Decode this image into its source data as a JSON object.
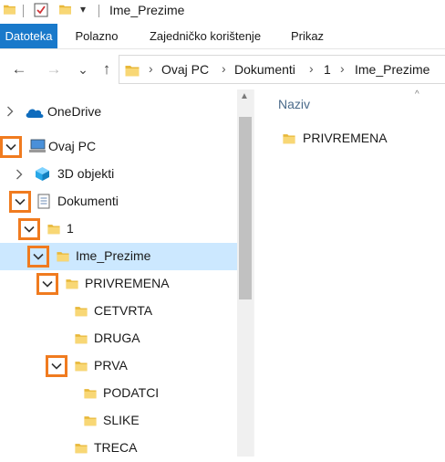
{
  "window": {
    "title": "Ime_Prezime",
    "quick_access_arrow": "▾"
  },
  "ribbon": {
    "tabs": [
      {
        "label": "Datoteka",
        "active": true
      },
      {
        "label": "Polazno",
        "active": false
      },
      {
        "label": "Zajedničko korištenje",
        "active": false
      },
      {
        "label": "Prikaz",
        "active": false
      }
    ]
  },
  "nav": {
    "back": "←",
    "forward": "→",
    "recent": "⌄",
    "up": "↑"
  },
  "address": {
    "crumbs": [
      "Ovaj PC",
      "Dokumenti",
      "1",
      "Ime_Prezime"
    ],
    "separator": "›"
  },
  "tree": {
    "items": [
      {
        "label": "OneDrive"
      },
      {
        "label": "Ovaj PC"
      },
      {
        "label": "3D objekti"
      },
      {
        "label": "Dokumenti"
      },
      {
        "label": "1"
      },
      {
        "label": "Ime_Prezime"
      },
      {
        "label": "PRIVREMENA"
      },
      {
        "label": "CETVRTA"
      },
      {
        "label": "DRUGA"
      },
      {
        "label": "PRVA"
      },
      {
        "label": "PODATCI"
      },
      {
        "label": "SLIKE"
      },
      {
        "label": "TRECA"
      }
    ]
  },
  "content": {
    "column_header": "Naziv",
    "items": [
      {
        "label": "PRIVREMENA"
      }
    ]
  },
  "colors": {
    "accent": "#1979ca",
    "selected_row": "#cce8ff",
    "highlight_box": "#f07b1f",
    "folder": "#f7c948"
  }
}
